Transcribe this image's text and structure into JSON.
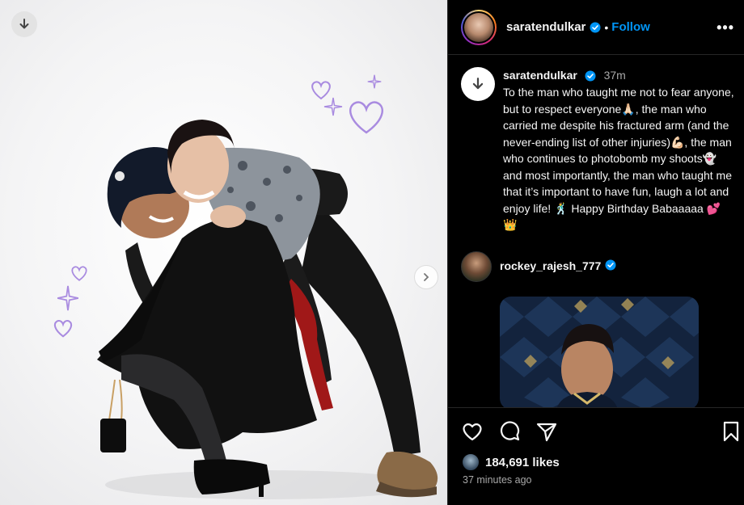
{
  "post": {
    "author": "saratendulkar",
    "verified": true,
    "follow_label": "Follow",
    "more_label": "•••"
  },
  "caption": {
    "username": "saratendulkar",
    "time": "37m",
    "text": "To the man who taught me not to fear anyone, but to respect everyone🙏🏻, the man who carried me despite his fractured arm (and the never-ending list of other injuries)💪🏻, the man who continues to photobomb my shoots👻 and most importantly, the man who taught me that it’s important to have fun, laugh a lot and enjoy life! 🕺 Happy Birthday Babaaaaa 💕 👑"
  },
  "comments": [
    {
      "username": "rockey_rajesh_777",
      "verified": true
    }
  ],
  "engagement": {
    "likes_label": "184,691 likes",
    "posted_ago": "37 minutes ago"
  },
  "colors": {
    "accent": "#0095f6",
    "background": "#000000",
    "muted": "#a8a8a8",
    "doodle": "#a98be0"
  },
  "icons": {
    "download": "download-icon",
    "next": "chevron-right-icon",
    "verified": "verified-badge-icon",
    "like": "heart-icon",
    "comment": "comment-icon",
    "share": "share-icon",
    "save": "bookmark-icon",
    "more": "more-options-icon"
  }
}
